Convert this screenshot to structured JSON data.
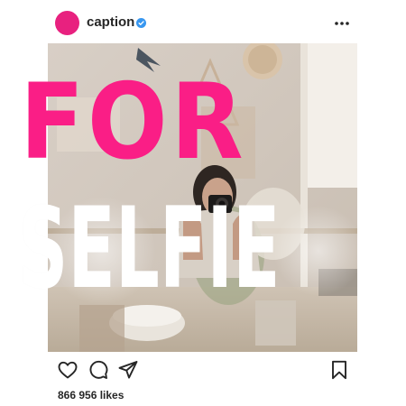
{
  "header": {
    "username": "caption",
    "avatar_color": "#e8217f",
    "verified_color": "#3897f0",
    "more_icon": "more-horizontal-icon"
  },
  "post": {
    "headline_line1": "FOR",
    "headline_line2": "SELFIE",
    "headline_line1_color": "#fa1e86",
    "headline_line2_color": "#ffffff"
  },
  "actions": {
    "like_icon": "heart-icon",
    "comment_icon": "comment-icon",
    "share_icon": "send-icon",
    "save_icon": "bookmark-icon"
  },
  "likes_text": "866 956 likes"
}
